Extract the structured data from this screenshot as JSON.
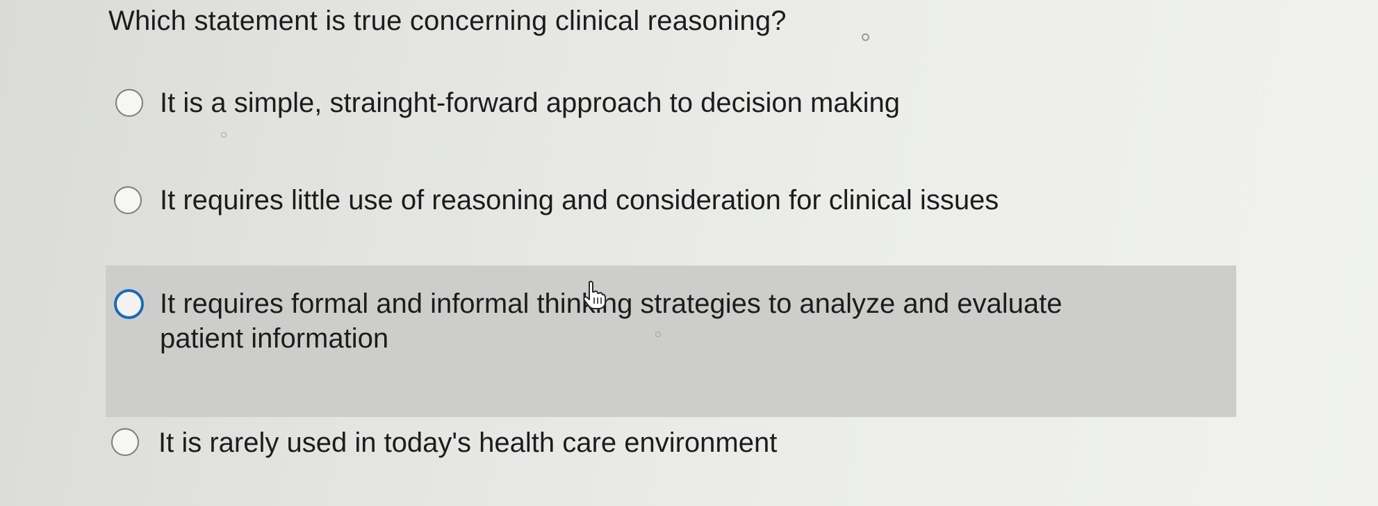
{
  "question": {
    "text": "Which statement is true concerning clinical reasoning?"
  },
  "options": [
    {
      "text": "It is a simple, strainght-forward approach to decision making",
      "selected": false,
      "highlighted": false
    },
    {
      "text": "It requires little use of reasoning and consideration for clinical issues",
      "selected": false,
      "highlighted": false
    },
    {
      "text": "It requires formal and informal thinking strategies to analyze and evaluate patient information",
      "selected": false,
      "highlighted": true
    },
    {
      "text": "It is rarely used in today's health care environment",
      "selected": false,
      "highlighted": false
    }
  ],
  "colors": {
    "highlight_background": "#cdcecc",
    "focused_radio_border": "#1d69b7",
    "radio_border": "#7b7d7b",
    "text": "#1c1c1c"
  },
  "icons": {
    "cursor": "hand-pointer-icon",
    "radio": "radio-circle-icon"
  }
}
